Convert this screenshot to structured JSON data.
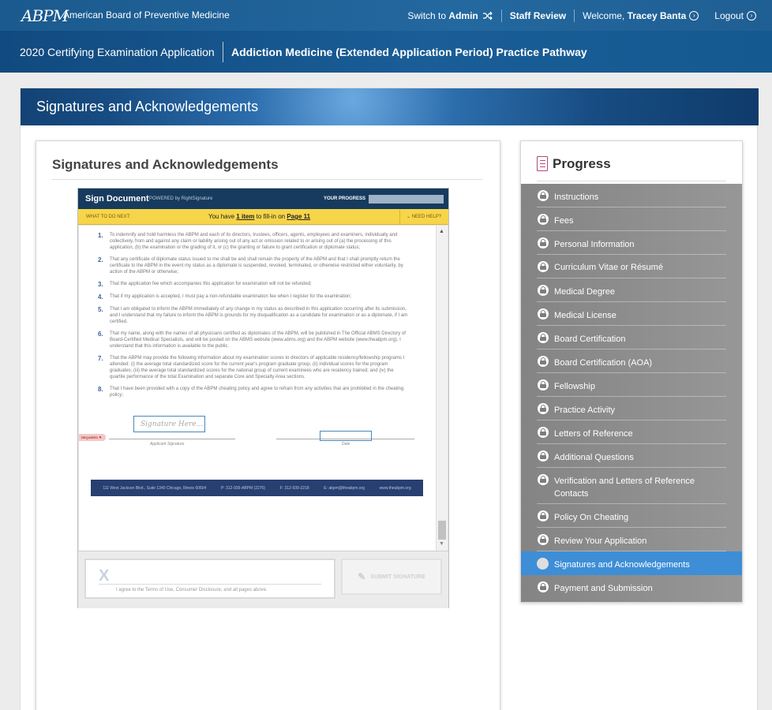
{
  "topbar": {
    "logo": "ABPM",
    "org": "American Board of Preventive Medicine",
    "switch_prefix": "Switch to ",
    "switch_target": "Admin",
    "staff_review": "Staff Review",
    "welcome_prefix": "Welcome, ",
    "user_name": "Tracey Banta",
    "logout": "Logout"
  },
  "subheader": {
    "application": "2020 Certifying Examination Application",
    "pathway": "Addiction Medicine (Extended Application Period) Practice Pathway"
  },
  "banner": {
    "title": "Signatures and Acknowledgements"
  },
  "section": {
    "title": "Signatures and Acknowledgements"
  },
  "document": {
    "brand": "Sign Document",
    "powered": "POWERED by RightSignature",
    "your_progress": "YOUR PROGRESS",
    "what_to_do": "WHAT TO DO NEXT:",
    "msg_prefix": "You have ",
    "msg_items": "1 item",
    "msg_mid": " to fill-in on ",
    "msg_page": "Page 11",
    "need_help": "NEED HELP?",
    "clauses": [
      {
        "num": "1.",
        "text": "To indemnify and hold harmless the ABPM and each of its directors, trustees, officers, agents, employees and examiners, individually and collectively, from and against any claim or liability arising out of any act or omission related to or arising out of (a) the processing of this application, (b) the examination or the grading of it, or (c) the granting or failure to grant certification or diplomate status;"
      },
      {
        "num": "2.",
        "text": "That any certificate of diplomate status issued to me shall be and shall remain the property of the ABPM and that I shall promptly return the certificate to the ABPM in the event my status as a diplomate is suspended, revoked, terminated, or otherwise restricted either voluntarily, by action of the ABPM or otherwise;"
      },
      {
        "num": "3.",
        "text": "That the application fee which accompanies this application for examination will not be refunded;"
      },
      {
        "num": "4.",
        "text": "That if my application is accepted, I must pay a non-refundable examination fee when I register for the examination;"
      },
      {
        "num": "5.",
        "text": "That I am obligated to inform the ABPM immediately of any change in my status as described in this application occurring after its submission, and I understand that my failure to inform the ABPM is grounds for my disqualification as a candidate for examination or as a diplomate, if I am certified."
      },
      {
        "num": "6.",
        "text": "That my name, along with the names of all physicians certified as diplomates of the ABPM, will be published in The Official ABMS Directory of Board-Certified Medical Specialists, and will be posted on the ABMS website (www.abms.org) and the ABPM website (www.theabpm.org). I understand that this information is available to the public."
      },
      {
        "num": "7.",
        "text": "That the ABPM may provide the following information about my examination scores to directors of applicable residency/fellowship programs I attended: (i) the average total standardized score for the current year's program graduate group, (ii) individual scores for the program graduates; (iii) the average total standardized scores for the national group of current examinees who are residency trained; and (iv) the quartile performance of the total Examination and separate Core and Specialty Area sections."
      },
      {
        "num": "8.",
        "text": "That I have been provided with a copy of the ABPM cheating policy and agree to refrain from any activities that are prohibited in the cheating policy;"
      }
    ],
    "signature_placeholder": "Signature Here...",
    "required_tag": "REQUIRED",
    "applicant_signature": "Applicant Signature",
    "date_label": "Date",
    "footer": {
      "address": "111 West Jackson Blvd., Suite 1340 Chicago, Illinois 60604",
      "phone": "P: 312-939-ABPM (2276)",
      "fax": "F: 312-939-2218",
      "email": "E: abpm@theabpm.org",
      "web": "www.theabpm.org"
    },
    "agree_x": "X",
    "agree_text": "I agree to the Terms of Use, Consumer Disclosure, and all pages above.",
    "submit_label": "SUBMIT SIGNATURE"
  },
  "progress": {
    "title": "Progress",
    "items": [
      {
        "label": "Instructions",
        "status": "locked"
      },
      {
        "label": "Fees",
        "status": "locked"
      },
      {
        "label": "Personal Information",
        "status": "locked"
      },
      {
        "label": "Curriculum Vitae or Résumé",
        "status": "locked"
      },
      {
        "label": "Medical Degree",
        "status": "locked"
      },
      {
        "label": "Medical License",
        "status": "locked"
      },
      {
        "label": "Board Certification",
        "status": "locked"
      },
      {
        "label": "Board Certification (AOA)",
        "status": "locked"
      },
      {
        "label": "Fellowship",
        "status": "locked"
      },
      {
        "label": "Practice Activity",
        "status": "locked"
      },
      {
        "label": "Letters of Reference",
        "status": "locked"
      },
      {
        "label": "Additional Questions",
        "status": "locked"
      },
      {
        "label": "Verification and Letters of Reference Contacts",
        "status": "locked"
      },
      {
        "label": "Policy On Cheating",
        "status": "locked"
      },
      {
        "label": "Review Your Application",
        "status": "locked"
      },
      {
        "label": "Signatures and Acknowledgements",
        "status": "current"
      },
      {
        "label": "Payment and Submission",
        "status": "locked"
      }
    ]
  },
  "colors": {
    "header_blue": "#1d5c8f",
    "active_item": "#3d8ed6",
    "progress_bg": "#8b8b8b",
    "doc_yellow": "#f6d54a"
  }
}
